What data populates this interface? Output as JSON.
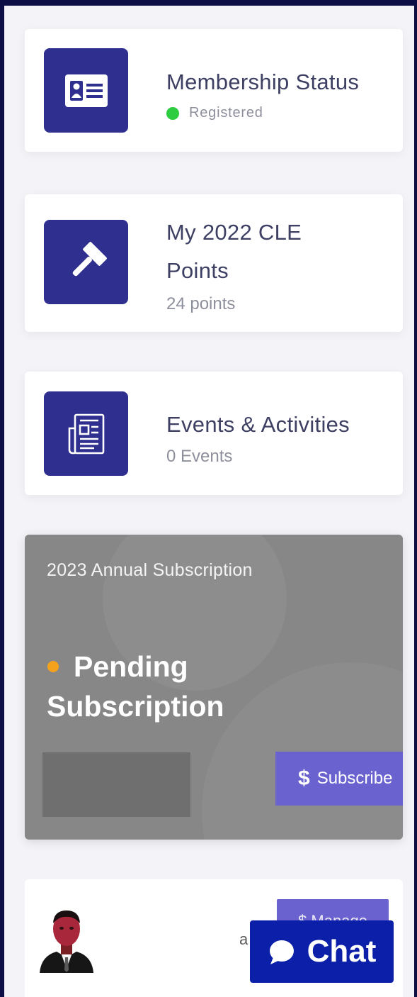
{
  "cards": {
    "membership": {
      "title": "Membership Status",
      "status": "Registered",
      "icon": "id-card-icon",
      "status_color": "#2ecc40"
    },
    "cle": {
      "title_line1": "My 2022 CLE",
      "title_line2": "Points",
      "value": "24 points",
      "icon": "gavel-icon"
    },
    "events": {
      "title": "Events & Activities",
      "value": "0 Events",
      "icon": "newspaper-icon"
    }
  },
  "subscription": {
    "label": "2023 Annual Subscription",
    "status_line1": "Pending",
    "status_line2": "Subscription",
    "status_color": "#f4a21b",
    "button_icon": "$",
    "button_label": "Subscribe"
  },
  "profile": {
    "manage_label": "$ Manage",
    "name_fragment": "a"
  },
  "chat": {
    "label": "Chat",
    "icon": "chat-bubble-icon"
  },
  "colors": {
    "background": "#0d0e45",
    "icon_box": "#2e2f8f",
    "accent_button": "#6a62cf",
    "chat_button": "#0b1fa8"
  }
}
